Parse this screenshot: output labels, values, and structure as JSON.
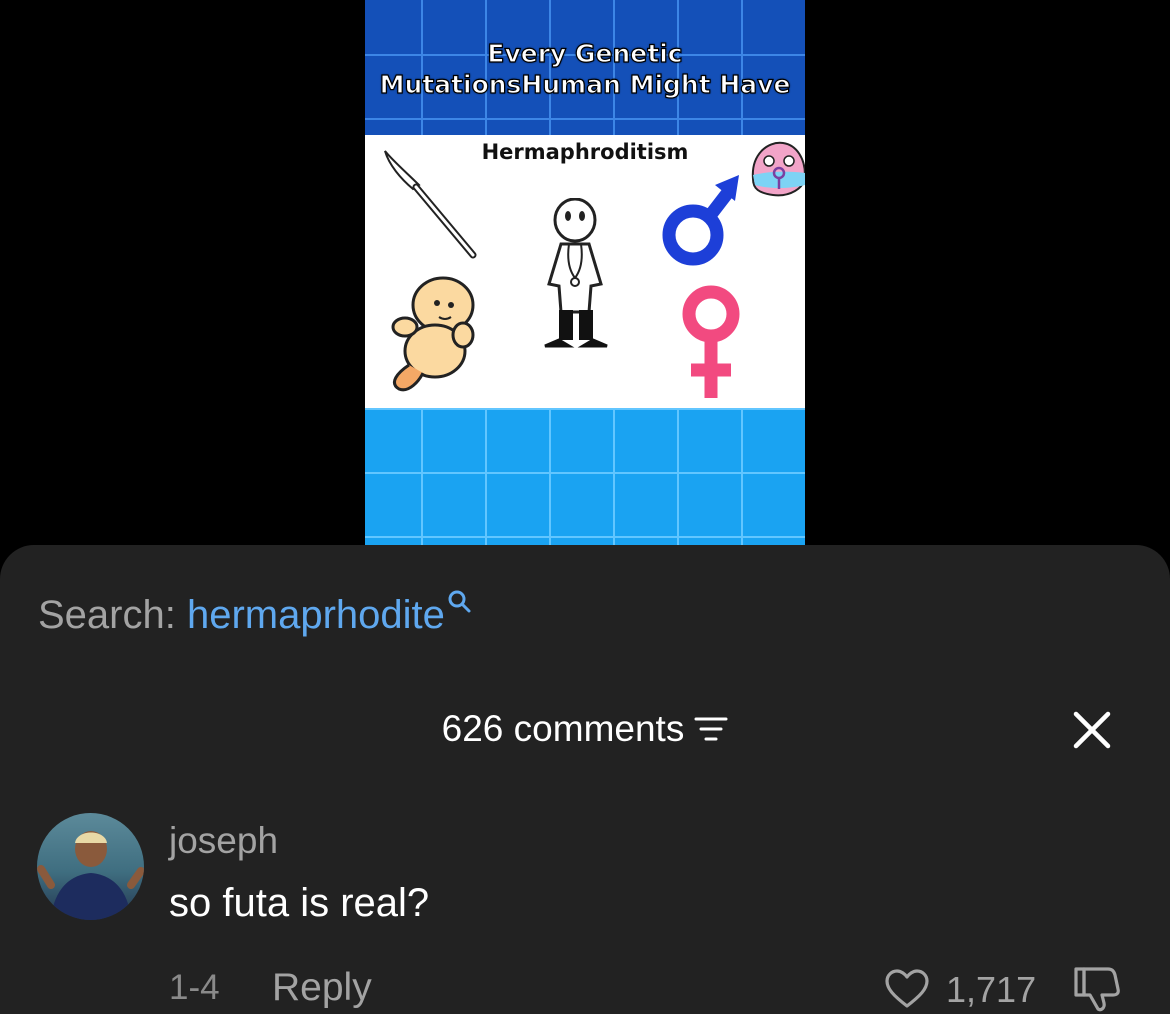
{
  "video": {
    "title_line1": "Every Genetic",
    "title_line2": "MutationsHuman Might Have",
    "panel_title": "Hermaphroditism"
  },
  "search": {
    "label": "Search:",
    "term": "hermaprhodite"
  },
  "comments_header": {
    "count_text": "626 comments"
  },
  "comment": {
    "username": "joseph",
    "text": "so futa is real?",
    "date": "1-4",
    "reply_label": "Reply",
    "likes": "1,717"
  },
  "colors": {
    "sheet_bg": "#222222",
    "search_link": "#5fa8ef",
    "muted_text": "#a3a3a3",
    "male_symbol": "#1d3fd8",
    "female_symbol": "#f24a80"
  }
}
